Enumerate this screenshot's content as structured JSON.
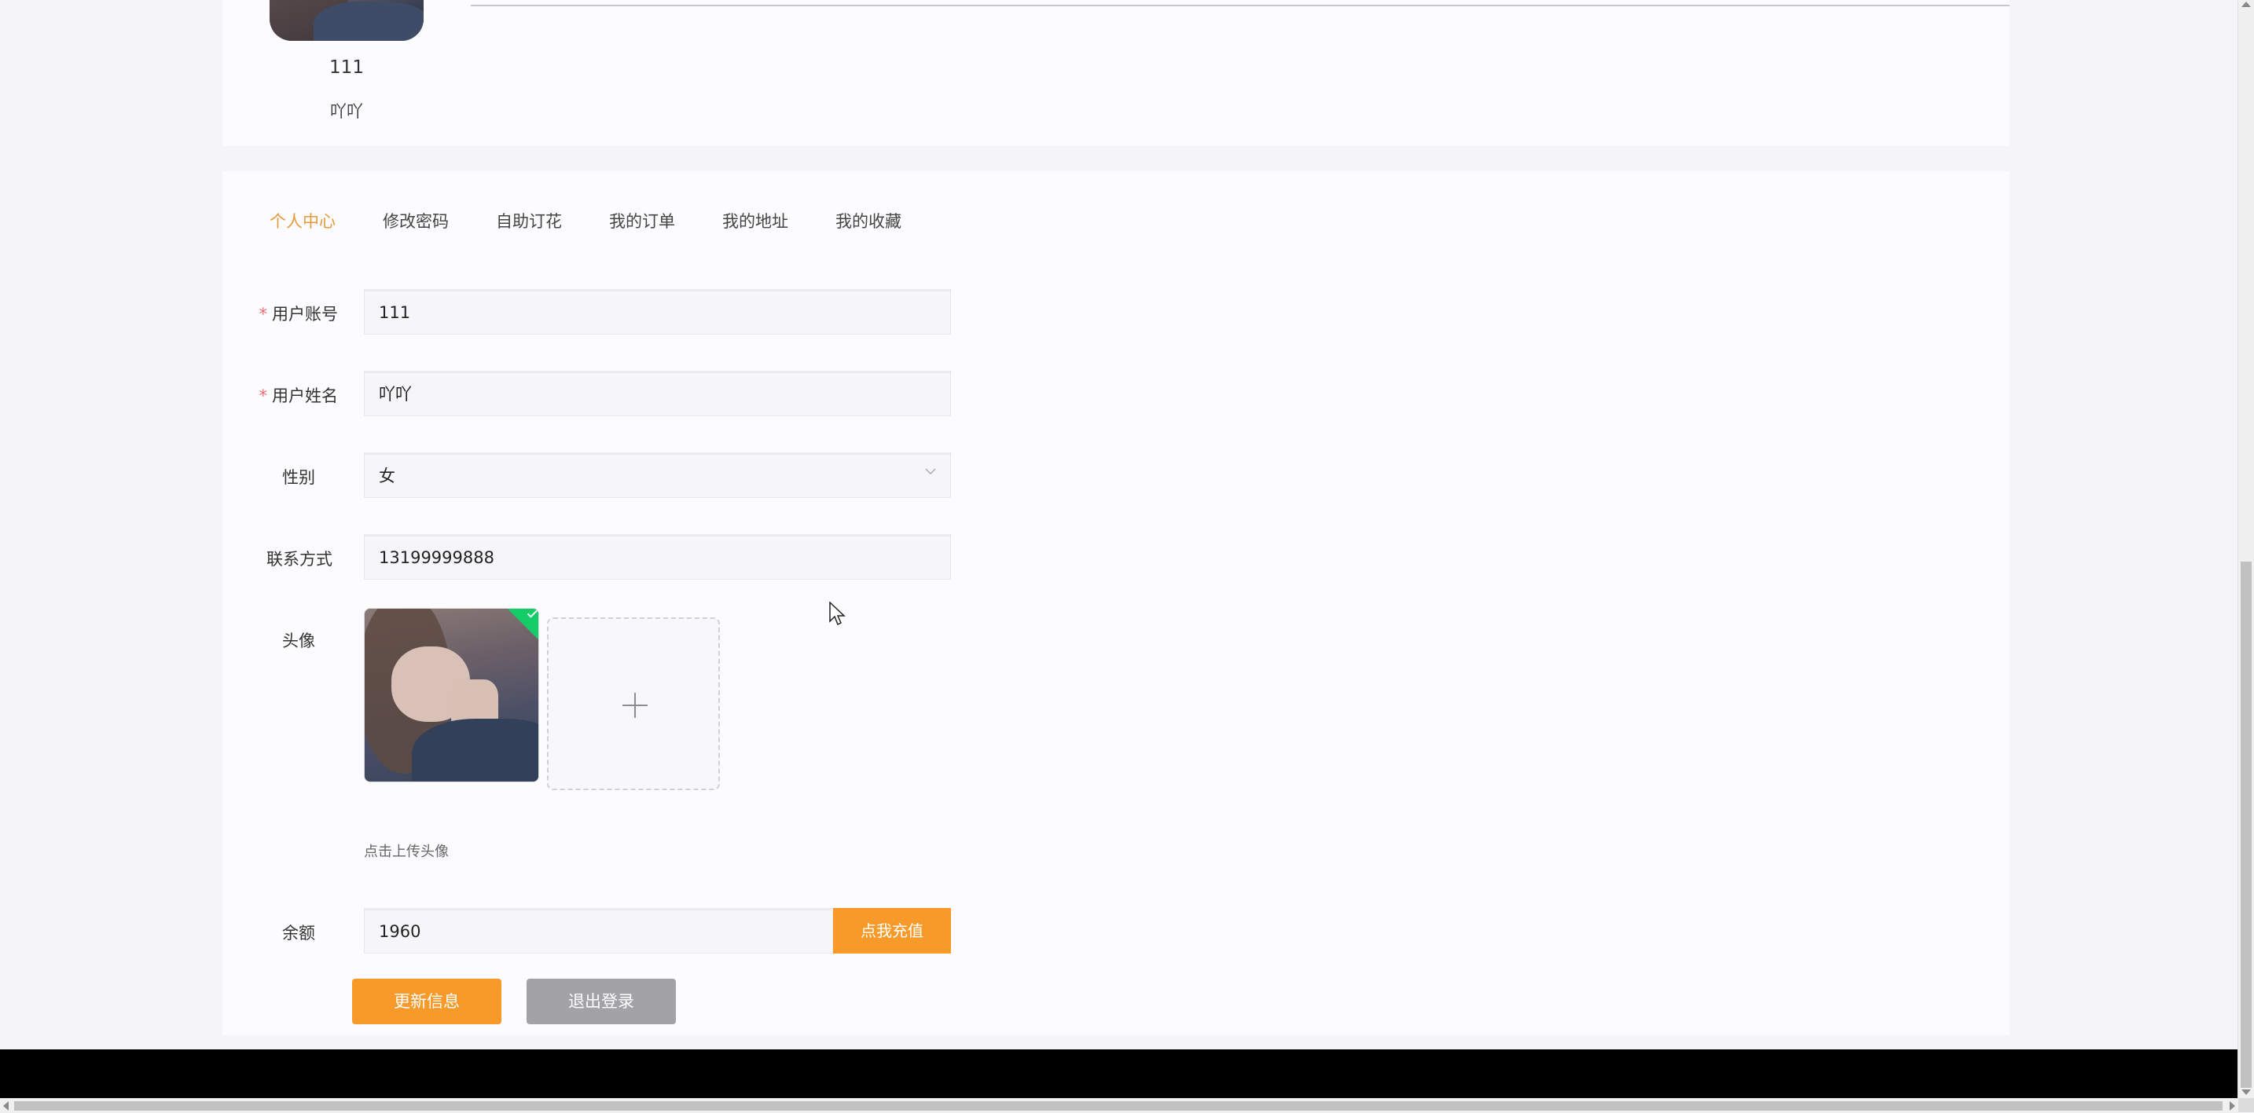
{
  "profile_header": {
    "username": "111",
    "name": "吖吖"
  },
  "tabs": [
    {
      "label": "个人中心",
      "active": true
    },
    {
      "label": "修改密码",
      "active": false
    },
    {
      "label": "自助订花",
      "active": false
    },
    {
      "label": "我的订单",
      "active": false
    },
    {
      "label": "我的地址",
      "active": false
    },
    {
      "label": "我的收藏",
      "active": false
    }
  ],
  "form": {
    "account": {
      "label": "用户账号",
      "required_mark": "*",
      "value": "111"
    },
    "name": {
      "label": "用户姓名",
      "required_mark": "*",
      "value": "吖吖"
    },
    "gender": {
      "label": "性别",
      "value": "女"
    },
    "phone": {
      "label": "联系方式",
      "value": "13199999888"
    },
    "avatar": {
      "label": "头像",
      "hint": "点击上传头像"
    },
    "balance": {
      "label": "余额",
      "value": "1960",
      "recharge_label": "点我充值"
    }
  },
  "actions": {
    "update_label": "更新信息",
    "logout_label": "退出登录"
  },
  "colors": {
    "accent": "#f79a2a",
    "active_tab": "#e59a3d",
    "required": "#f56c6c",
    "success": "#13ce66",
    "logout_button": "#a3a2a6"
  },
  "icons": [
    "check-icon",
    "plus-icon",
    "chevron-down-icon",
    "mouse-cursor-icon"
  ]
}
